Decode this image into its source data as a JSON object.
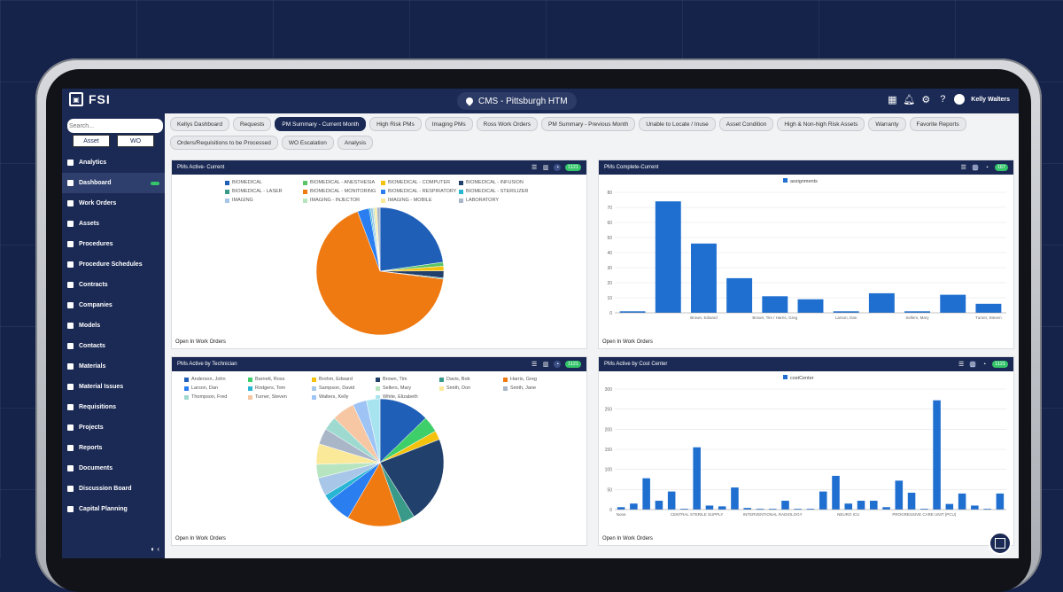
{
  "app": {
    "brand": "FSI",
    "site": "CMS - Pittsburgh HTM",
    "user": "Kelly Walters"
  },
  "sidebar": {
    "search_placeholder": "Search...",
    "toggle": [
      "Asset",
      "WO"
    ],
    "items": [
      {
        "label": "Analytics",
        "icon": "analytics-icon"
      },
      {
        "label": "Dashboard",
        "icon": "dashboard-icon",
        "active": true
      },
      {
        "label": "Work Orders",
        "icon": "work-orders-icon"
      },
      {
        "label": "Assets",
        "icon": "assets-icon"
      },
      {
        "label": "Procedures",
        "icon": "procedures-icon"
      },
      {
        "label": "Procedure Schedules",
        "icon": "schedule-icon"
      },
      {
        "label": "Contracts",
        "icon": "contracts-icon"
      },
      {
        "label": "Companies",
        "icon": "companies-icon"
      },
      {
        "label": "Models",
        "icon": "models-icon"
      },
      {
        "label": "Contacts",
        "icon": "contacts-icon"
      },
      {
        "label": "Materials",
        "icon": "materials-icon"
      },
      {
        "label": "Material Issues",
        "icon": "material-issues-icon"
      },
      {
        "label": "Requisitions",
        "icon": "requisitions-icon"
      },
      {
        "label": "Projects",
        "icon": "projects-icon"
      },
      {
        "label": "Reports",
        "icon": "reports-icon"
      },
      {
        "label": "Documents",
        "icon": "documents-icon"
      },
      {
        "label": "Discussion Board",
        "icon": "discussion-icon"
      },
      {
        "label": "Capital Planning",
        "icon": "capital-icon"
      }
    ]
  },
  "tabs_row1": [
    "Kellys Dashboard",
    "Requests",
    "PM Summary - Current Month",
    "High Risk PMs",
    "Imaging PMs",
    "Ross Work Orders",
    "PM Summary - Previous Month",
    "Unable to Locate / Inuse",
    "Asset Condition",
    "High & Non-high Risk Assets",
    "Warranty",
    "Favorite Reports"
  ],
  "tabs_row2": [
    "Orders/Requisitions to be Processed",
    "WO Escalation",
    "Analysis"
  ],
  "active_tab": "PM Summary - Current Month",
  "panels": {
    "p1": {
      "title": "PMs Active- Current",
      "badge": "1121",
      "footer": "Open In Work Orders"
    },
    "p2": {
      "title": "PMs Complete-Current",
      "badge": "167",
      "footer": "Open In Work Orders"
    },
    "p3": {
      "title": "PMs Active by Technician",
      "badge": "1121",
      "footer": "Open In Work Orders"
    },
    "p4": {
      "title": "PMs Active by Cost Center",
      "badge": "1121",
      "footer": "Open In Work Orders"
    }
  },
  "chart_data": [
    {
      "type": "pie",
      "title": "PMs Active- Current",
      "legend": [
        {
          "name": "BIOMEDICAL",
          "color": "#1f5fb8"
        },
        {
          "name": "BIOMEDICAL - ANESTHESIA",
          "color": "#5bc466"
        },
        {
          "name": "BIOMEDICAL - COMPUTER",
          "color": "#f4c20d"
        },
        {
          "name": "BIOMEDICAL - INFUSION",
          "color": "#21406b"
        },
        {
          "name": "BIOMEDICAL - LASER",
          "color": "#3a9a8a"
        },
        {
          "name": "BIOMEDICAL - MONITORING",
          "color": "#f07a12"
        },
        {
          "name": "BIOMEDICAL - RESPIRATORY",
          "color": "#2a7ef0"
        },
        {
          "name": "BIOMEDICAL - STERILIZER",
          "color": "#28b6d4"
        },
        {
          "name": "IMAGING",
          "color": "#a8c6e8"
        },
        {
          "name": "IMAGING - INJECTOR",
          "color": "#b7e5c0"
        },
        {
          "name": "IMAGING - MOBILE",
          "color": "#fbe99a"
        },
        {
          "name": "LABORATORY",
          "color": "#a9b6c8"
        }
      ],
      "values": [
        230,
        10,
        12,
        18,
        3,
        680,
        30,
        4,
        6,
        4,
        6,
        8
      ]
    },
    {
      "type": "bar",
      "title": "PMs Complete-Current",
      "series": [
        {
          "name": "assignments",
          "values": [
            1,
            74,
            46,
            23,
            11,
            9,
            1,
            13,
            1,
            12,
            6
          ]
        }
      ],
      "categories": [
        "",
        "",
        "Brown, Edward",
        "",
        "Brown, Tim / Harris, Greg",
        "",
        "Larson, Dan",
        "",
        "Sellers, Mary",
        "",
        "Turner, Steven"
      ],
      "ylim": [
        0,
        80
      ],
      "yticks": [
        0,
        10,
        20,
        30,
        40,
        50,
        60,
        70,
        80
      ]
    },
    {
      "type": "pie",
      "title": "PMs Active by Technician",
      "legend": [
        {
          "name": "Anderson, John",
          "color": "#1f5fb8"
        },
        {
          "name": "Barnett, Ross",
          "color": "#3ecf6a"
        },
        {
          "name": "Brohm, Edward",
          "color": "#f4c20d"
        },
        {
          "name": "Brown, Tim",
          "color": "#21406b"
        },
        {
          "name": "Davis, Bob",
          "color": "#3a9a8a"
        },
        {
          "name": "Harris, Greg",
          "color": "#f07a12"
        },
        {
          "name": "Larson, Dan",
          "color": "#2a7ef0"
        },
        {
          "name": "Rodgers, Tom",
          "color": "#28b6d4"
        },
        {
          "name": "Sampson, David",
          "color": "#a8c6e8"
        },
        {
          "name": "Sellers, Mary",
          "color": "#b7e5c0"
        },
        {
          "name": "Smith, Don",
          "color": "#fbe99a"
        },
        {
          "name": "Smith, Jane",
          "color": "#a9b6c8"
        },
        {
          "name": "Thompson, Fred",
          "color": "#9fdad0"
        },
        {
          "name": "Turner, Steven",
          "color": "#f7c7a4"
        },
        {
          "name": "Walters, Kelly",
          "color": "#9ec3f5"
        },
        {
          "name": "White, Elizabeth",
          "color": "#a8e4f0"
        }
      ],
      "values": [
        110,
        35,
        20,
        190,
        30,
        120,
        55,
        15,
        40,
        30,
        45,
        35,
        30,
        50,
        30,
        30
      ]
    },
    {
      "type": "bar",
      "title": "PMs Active by Cost Center",
      "series": [
        {
          "name": "costCenter",
          "values": [
            6,
            15,
            78,
            22,
            45,
            2,
            155,
            10,
            8,
            55,
            4,
            2,
            2,
            22,
            2,
            2,
            45,
            84,
            15,
            22,
            22,
            6,
            72,
            42,
            2,
            272,
            14,
            40,
            10,
            2,
            40
          ]
        }
      ],
      "categories": [
        "None",
        "",
        "",
        "",
        "",
        "",
        "CENTRAL STERILE SUPPLY",
        "",
        "",
        "",
        "",
        "",
        "INTERVENTIONAL RADIOLOGY",
        "",
        "",
        "",
        "",
        "",
        "NEURO ICU",
        "",
        "",
        "",
        "",
        "",
        "PROGRESSIVE CARE UNIT (PCU)",
        "",
        "",
        "",
        "",
        "",
        ""
      ],
      "ylim": [
        0,
        300
      ],
      "yticks": [
        0,
        50,
        100,
        150,
        200,
        250,
        300
      ]
    }
  ]
}
